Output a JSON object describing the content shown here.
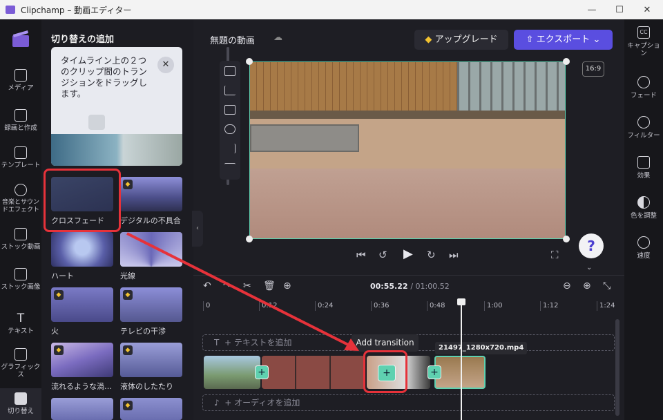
{
  "window": {
    "title": "Clipchamp – 動画エディター",
    "min": "—",
    "max": "☐",
    "close": "✕"
  },
  "left_nav": [
    {
      "label": "メディア",
      "icon": "folder-icon"
    },
    {
      "label": "録画と作成",
      "icon": "camera-icon"
    },
    {
      "label": "テンプレート",
      "icon": "template-icon"
    },
    {
      "label": "音楽とサウンドエフェクト",
      "icon": "music-icon"
    },
    {
      "label": "ストック動画",
      "icon": "film-icon"
    },
    {
      "label": "ストック画像",
      "icon": "image-icon"
    },
    {
      "label": "テキスト",
      "icon": "text-icon"
    },
    {
      "label": "グラフィックス",
      "icon": "shapes-icon"
    },
    {
      "label": "切り替え",
      "icon": "transition-icon"
    }
  ],
  "panel": {
    "title": "切り替えの追加",
    "tip_text": "タイムライン上の２つのクリップ間のトランジションをドラッグします。",
    "tiles": [
      {
        "label": "クロスフェード"
      },
      {
        "label": "デジタルの不具合"
      },
      {
        "label": "ハート"
      },
      {
        "label": "光線"
      },
      {
        "label": "火"
      },
      {
        "label": "テレビの干渉"
      },
      {
        "label": "流れるような渦…"
      },
      {
        "label": "液体のしたたり"
      }
    ]
  },
  "topbar": {
    "project_title": "無題の動画",
    "upgrade_label": "アップグレード",
    "export_label": "エクスポート"
  },
  "right_nav": [
    {
      "label": "キャプション",
      "icon": "cc-icon"
    },
    {
      "label": "フェード",
      "icon": "fade-icon"
    },
    {
      "label": "フィルター",
      "icon": "filter-icon"
    },
    {
      "label": "効果",
      "icon": "magic-wand-icon"
    },
    {
      "label": "色を調整",
      "icon": "contrast-icon"
    },
    {
      "label": "速度",
      "icon": "speedometer-icon"
    }
  ],
  "preview": {
    "aspect_ratio": "16:9"
  },
  "timeline": {
    "current_time": "00:55.22",
    "total_time": "/ 01:00.52",
    "ticks": [
      "0",
      "0:12",
      "0:24",
      "0:36",
      "0:48",
      "1:00",
      "1:12",
      "1:24"
    ],
    "text_track": "+ テキストを追加",
    "audio_track": "+ オーディオを追加",
    "tooltip": "Add transition",
    "clip_filename": "21497_1280x720.mp4"
  },
  "colors": {
    "accent": "#5a4ee0",
    "selection": "#5fd1b0",
    "annotation": "#e6323a"
  }
}
